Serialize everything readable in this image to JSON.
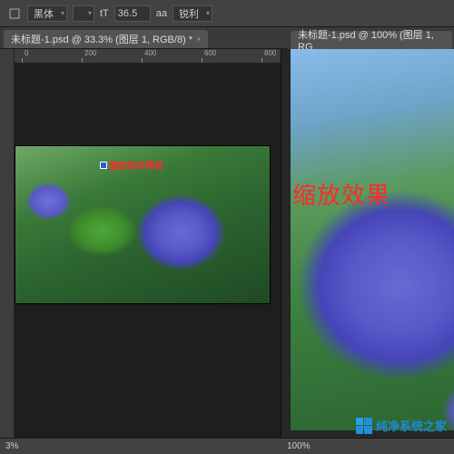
{
  "toolbar": {
    "font_family": "黑体",
    "font_size_label": "tT",
    "font_size_value": "36.5",
    "aa_label": "aa",
    "aa_value": "锐利"
  },
  "tabs": {
    "left": {
      "label": "未标题-1.psd @ 33.3% (图层 1, RGB/8) *"
    },
    "right": {
      "label": "未标题-1.psd @ 100% (图层 1, RG"
    }
  },
  "ruler": {
    "ticks": [
      "0",
      "200",
      "400",
      "600",
      "800"
    ]
  },
  "canvas": {
    "small_annotation": "缩放实时预览",
    "large_annotation": "缩放效果"
  },
  "status": {
    "left_zoom": "3%",
    "right_zoom": "100%"
  },
  "watermark": {
    "text": "纯净系统之家"
  }
}
